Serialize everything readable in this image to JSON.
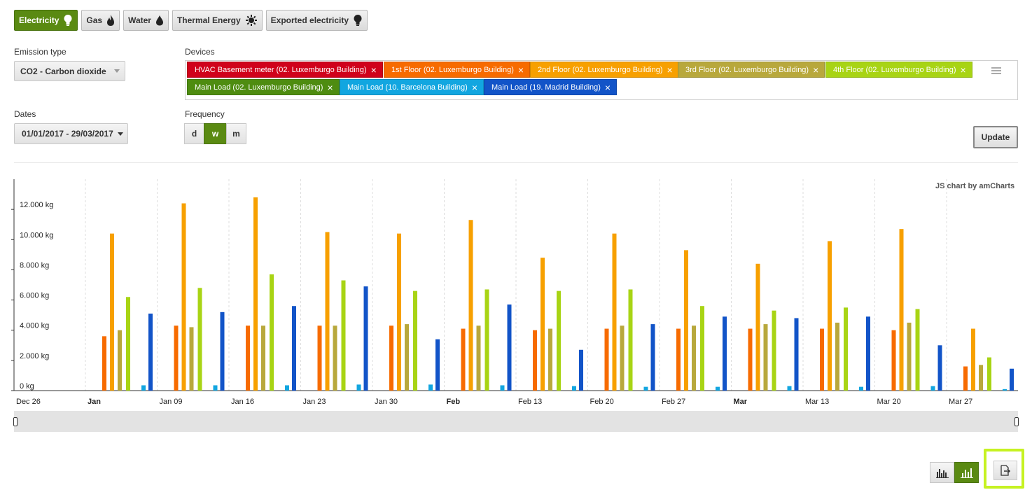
{
  "tabs": [
    {
      "label": "Electricity",
      "icon": "bulb-icon",
      "active": true
    },
    {
      "label": "Gas",
      "icon": "flame-icon",
      "active": false
    },
    {
      "label": "Water",
      "icon": "drop-icon",
      "active": false
    },
    {
      "label": "Thermal Energy",
      "icon": "thermal-icon",
      "active": false
    },
    {
      "label": "Exported electricity",
      "icon": "bulb-icon",
      "active": false
    }
  ],
  "labels": {
    "emission_type": "Emission type",
    "devices": "Devices",
    "dates": "Dates",
    "frequency": "Frequency"
  },
  "emission_select": {
    "value": "CO2 - Carbon dioxide"
  },
  "devices": [
    {
      "label": "HVAC Basement meter (02. Luxemburgo Building)",
      "color": "#d0021b"
    },
    {
      "label": "1st Floor (02. Luxemburgo Building)",
      "color": "#f76b00"
    },
    {
      "label": "2nd Floor (02. Luxemburgo Building)",
      "color": "#f7a000"
    },
    {
      "label": "3rd Floor (02. Luxemburgo Building)",
      "color": "#b8a83c"
    },
    {
      "label": "4th Floor (02. Luxemburgo Building)",
      "color": "#a8d414"
    },
    {
      "label": "Main Load (02. Luxemburgo Building)",
      "color": "#4e8c10"
    },
    {
      "label": "Main Load (10. Barcelona Building)",
      "color": "#12a6e0"
    },
    {
      "label": "Main Load (19. Madrid Building)",
      "color": "#1254c8"
    }
  ],
  "dates_select": {
    "value": "01/01/2017 - 29/03/2017"
  },
  "frequency": [
    {
      "label": "d",
      "active": false
    },
    {
      "label": "w",
      "active": true
    },
    {
      "label": "m",
      "active": false
    }
  ],
  "update_label": "Update",
  "chart_credit": "JS chart by amCharts",
  "chart_data": {
    "type": "bar",
    "ylim": [
      0,
      14000
    ],
    "y_ticks": [
      "0 kg",
      "2.000 kg",
      "4.000 kg",
      "6.000 kg",
      "8.000 kg",
      "10.000 kg",
      "12.000 kg"
    ],
    "x_ticks": [
      {
        "label": "Dec 26",
        "bold": false
      },
      {
        "label": "Jan",
        "bold": true
      },
      {
        "label": "Jan 09",
        "bold": false
      },
      {
        "label": "Jan 16",
        "bold": false
      },
      {
        "label": "Jan 23",
        "bold": false
      },
      {
        "label": "Jan 30",
        "bold": false
      },
      {
        "label": "Feb",
        "bold": true
      },
      {
        "label": "Feb 13",
        "bold": false
      },
      {
        "label": "Feb 20",
        "bold": false
      },
      {
        "label": "Feb 27",
        "bold": false
      },
      {
        "label": "Mar",
        "bold": true
      },
      {
        "label": "Mar 13",
        "bold": false
      },
      {
        "label": "Mar 20",
        "bold": false
      },
      {
        "label": "Mar 27",
        "bold": false
      }
    ],
    "series_colors": [
      "#f76b00",
      "#f7a000",
      "#b8a83c",
      "#a8d414",
      "#12a6e0",
      "#1254c8"
    ],
    "groups": [
      [
        3600,
        10400,
        4000,
        6200,
        350,
        5100
      ],
      [
        4300,
        12400,
        4200,
        6800,
        350,
        5200
      ],
      [
        4300,
        12800,
        4300,
        7700,
        350,
        5600
      ],
      [
        4300,
        10500,
        4300,
        7300,
        400,
        6900
      ],
      [
        4300,
        10400,
        4400,
        6600,
        400,
        3400
      ],
      [
        4100,
        11300,
        4300,
        6700,
        350,
        5700
      ],
      [
        4000,
        8800,
        4100,
        6600,
        300,
        2700
      ],
      [
        4100,
        10400,
        4300,
        6700,
        250,
        4400
      ],
      [
        4100,
        9300,
        4300,
        5600,
        250,
        4900
      ],
      [
        4100,
        8400,
        4400,
        5300,
        300,
        4800
      ],
      [
        4100,
        9900,
        4500,
        5500,
        250,
        4900
      ],
      [
        4000,
        10700,
        4500,
        5400,
        300,
        3000
      ],
      [
        1600,
        4100,
        1700,
        2200,
        100,
        1450
      ]
    ]
  },
  "view_buttons": [
    {
      "icon": "grouped-bars-icon",
      "active": false
    },
    {
      "icon": "bars-icon",
      "active": true
    }
  ],
  "export_icon": "export-icon"
}
